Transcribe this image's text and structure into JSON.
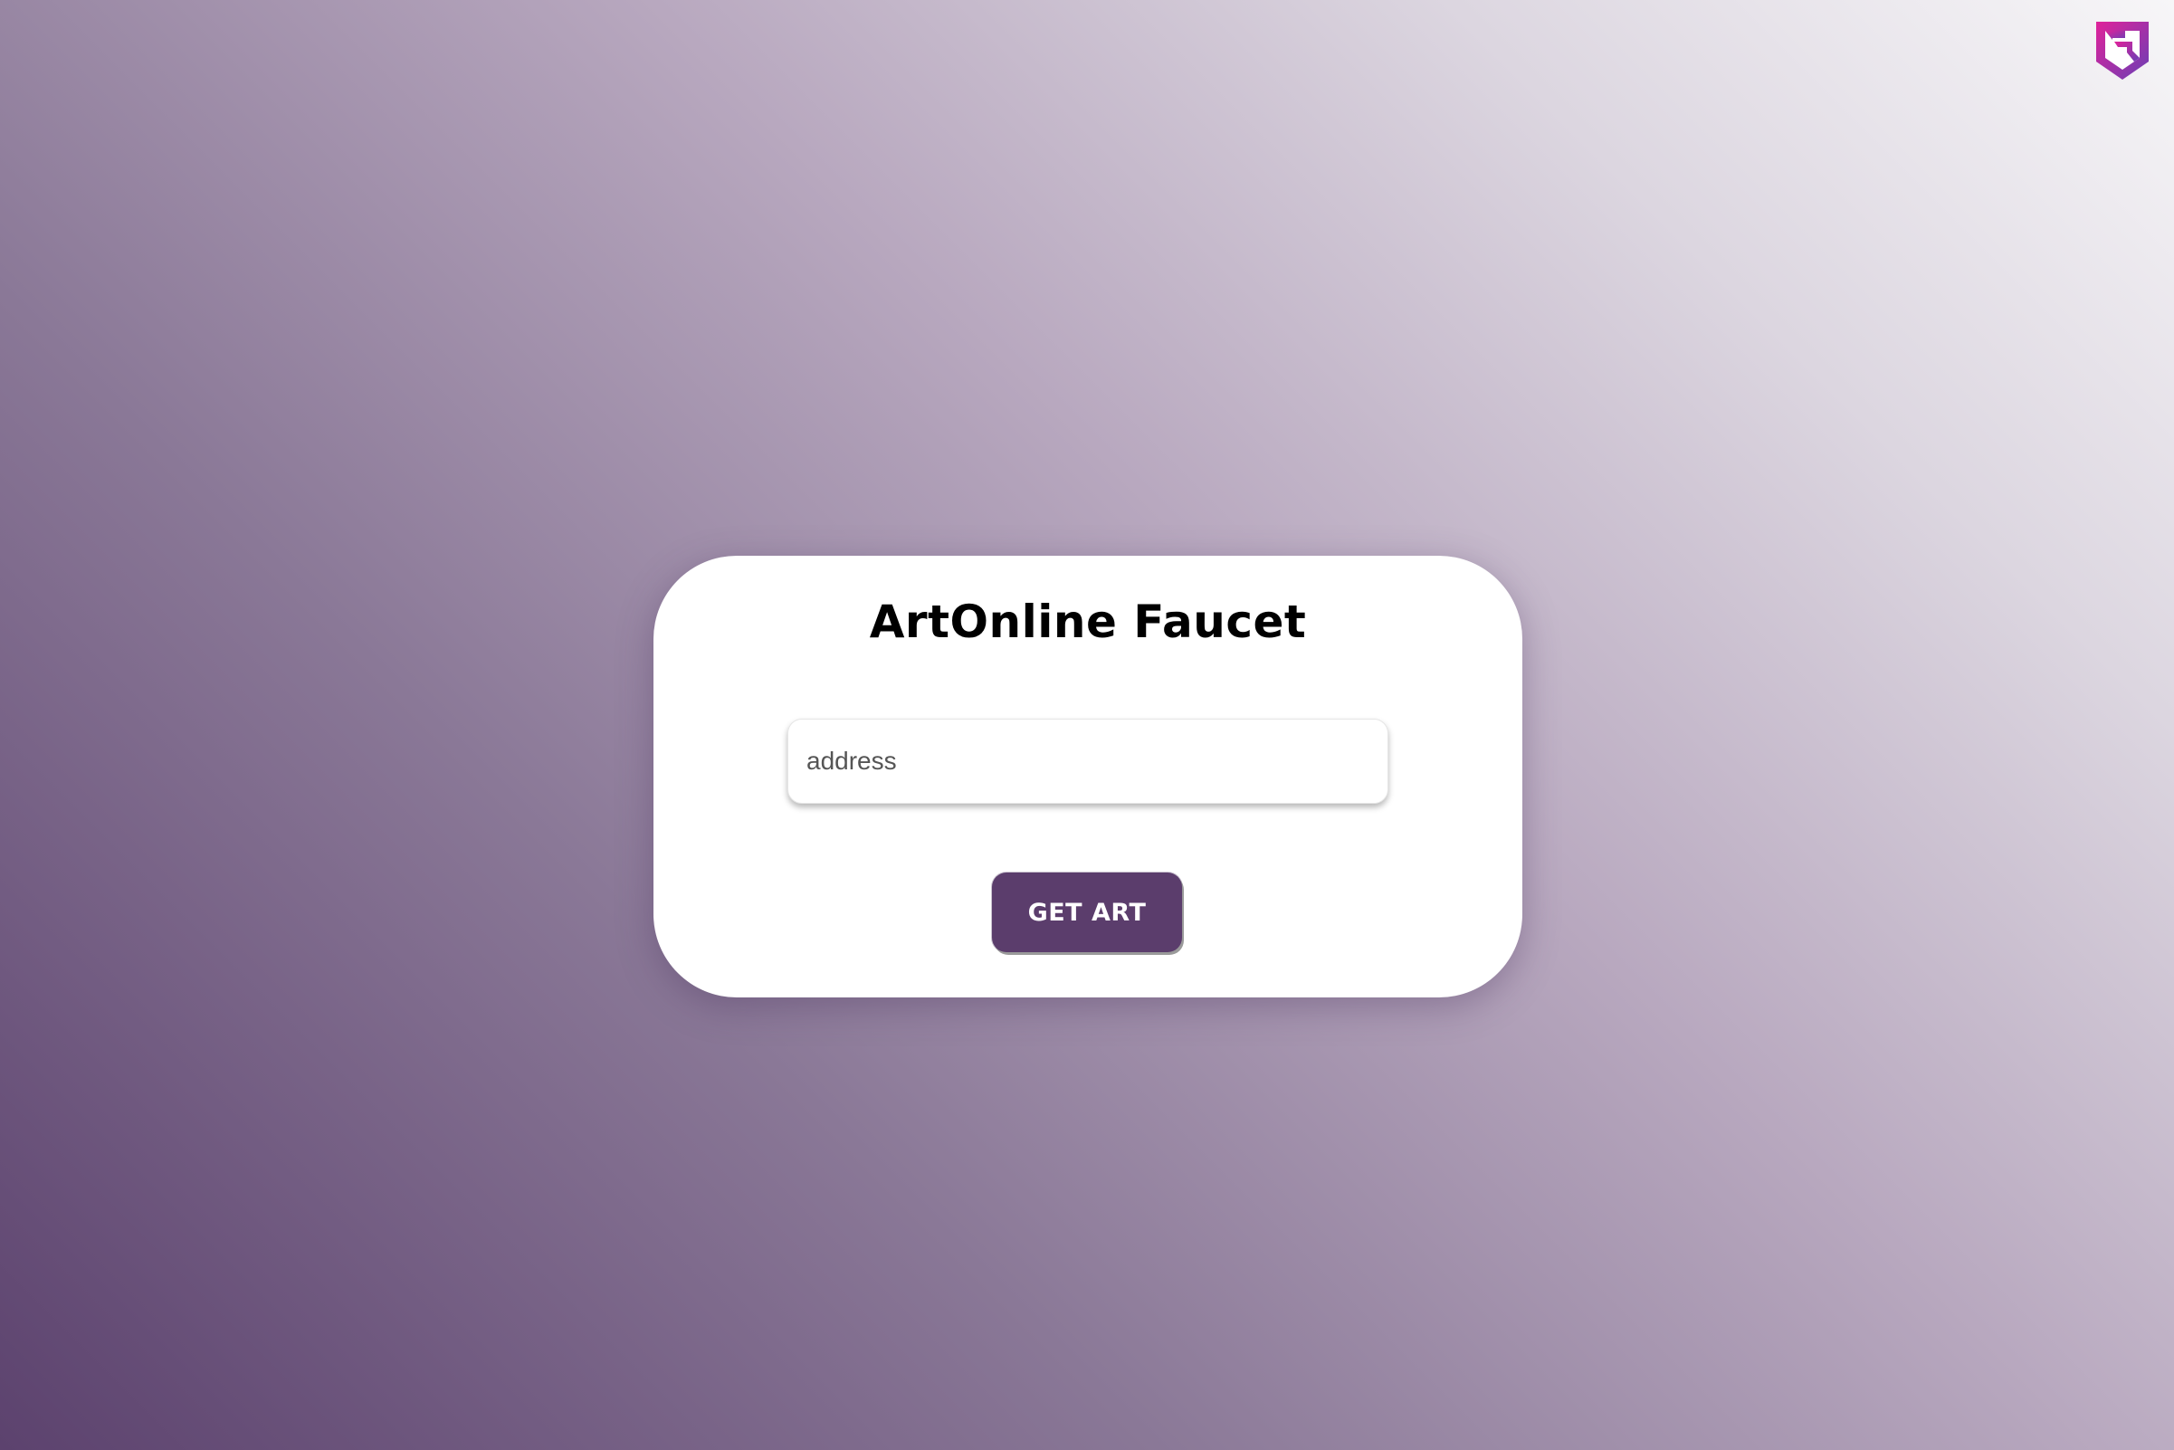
{
  "app": {
    "title": "ArtOnline Faucet"
  },
  "logo": {
    "icon": "artonline-shield-logo-icon",
    "colors": [
      "#e0229a",
      "#7a3fb8"
    ]
  },
  "form": {
    "address_placeholder": "address",
    "address_value": "",
    "submit_label": "GET ART"
  },
  "colors": {
    "accent": "#5b3d6c",
    "background_dark": "#5c426e",
    "background_light": "#f7f6f8"
  }
}
